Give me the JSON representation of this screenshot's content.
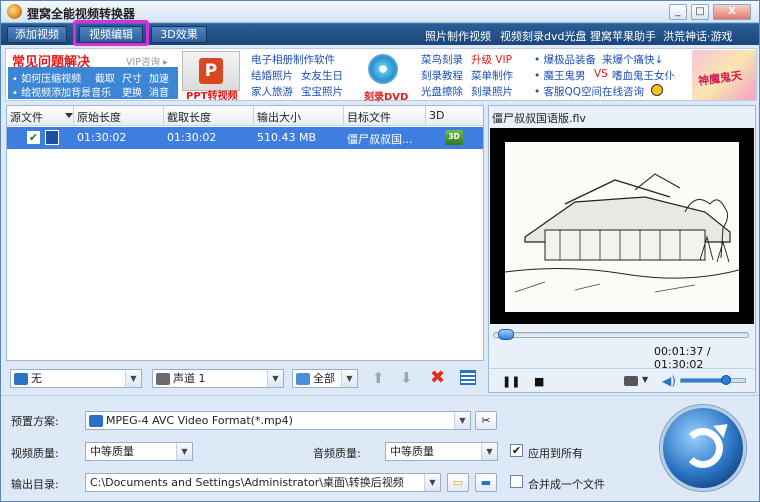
{
  "window": {
    "title": "狸窝全能视频转换器",
    "min": "_",
    "max": "□",
    "close": "X"
  },
  "toolbar": {
    "add_video": "添加视频",
    "edit_video": "视频编辑",
    "effect_3d": "3D效果",
    "links": [
      "照片制作视频",
      "视频刻录dvd光盘",
      "狸窝苹果助手",
      "洪荒神话·游戏"
    ]
  },
  "ads": {
    "faq_title": "常见问题解决",
    "vip_consult": "VIP咨询 ▸",
    "faq_row1": [
      "• 如何压缩视频",
      "截取",
      "尺寸",
      "加速"
    ],
    "faq_row2": [
      "• 给视频添加背景音乐",
      "更换",
      "消音"
    ],
    "ppt_caption": "PPT转视频",
    "col2": [
      [
        "电子相册制作软件"
      ],
      [
        "结婚照片",
        "女友生日"
      ],
      [
        "家人旅游",
        "宝宝照片"
      ]
    ],
    "dvd_caption": "刻录DVD",
    "col3": [
      [
        "菜鸟刻录",
        "升级 VIP"
      ],
      [
        "刻录教程",
        "菜单制作"
      ],
      [
        "光盘擦除",
        "刻录照片"
      ]
    ],
    "col4_row1": [
      "• 爆极品装备",
      "来爆个痛快↓"
    ],
    "col4_row2": [
      "• 魔王鬼男",
      "VS",
      "嗜血鬼王女仆"
    ],
    "col4_row3": [
      "• 客服QQ空间",
      "在线咨询"
    ],
    "game_text": "神魔鬼天"
  },
  "list": {
    "headers": [
      "源文件",
      "原始长度",
      "截取长度",
      "输出大小",
      "目标文件",
      "3D"
    ],
    "rows": [
      {
        "original_length": "01:30:02",
        "clip_length": "01:30:02",
        "output_size": "510.43 MB",
        "target": "僵尸叔叔国...",
        "fx": "3D"
      }
    ]
  },
  "listbar": {
    "subtitle": "无",
    "audio_channel": "声道 1",
    "select_all": "全部"
  },
  "preview": {
    "filename": "僵尸叔叔国语版.flv",
    "time": "00:01:37 / 01:30:02",
    "play": "❚❚",
    "stop": "■",
    "seek_fraction": 0.02,
    "volume_fraction": 0.7
  },
  "settings": {
    "preset_label": "预置方案:",
    "preset_value": "MPEG-4 AVC Video Format(*.mp4)",
    "video_quality_label": "视频质量:",
    "video_quality_value": "中等质量",
    "audio_quality_label": "音频质量:",
    "audio_quality_value": "中等质量",
    "apply_all_label": "应用到所有",
    "apply_all_checked": "✔",
    "output_dir_label": "输出目录:",
    "output_dir_value": "C:\\Documents and Settings\\Administrator\\桌面\\转换后视频",
    "merge_label": "合并成一个文件"
  }
}
